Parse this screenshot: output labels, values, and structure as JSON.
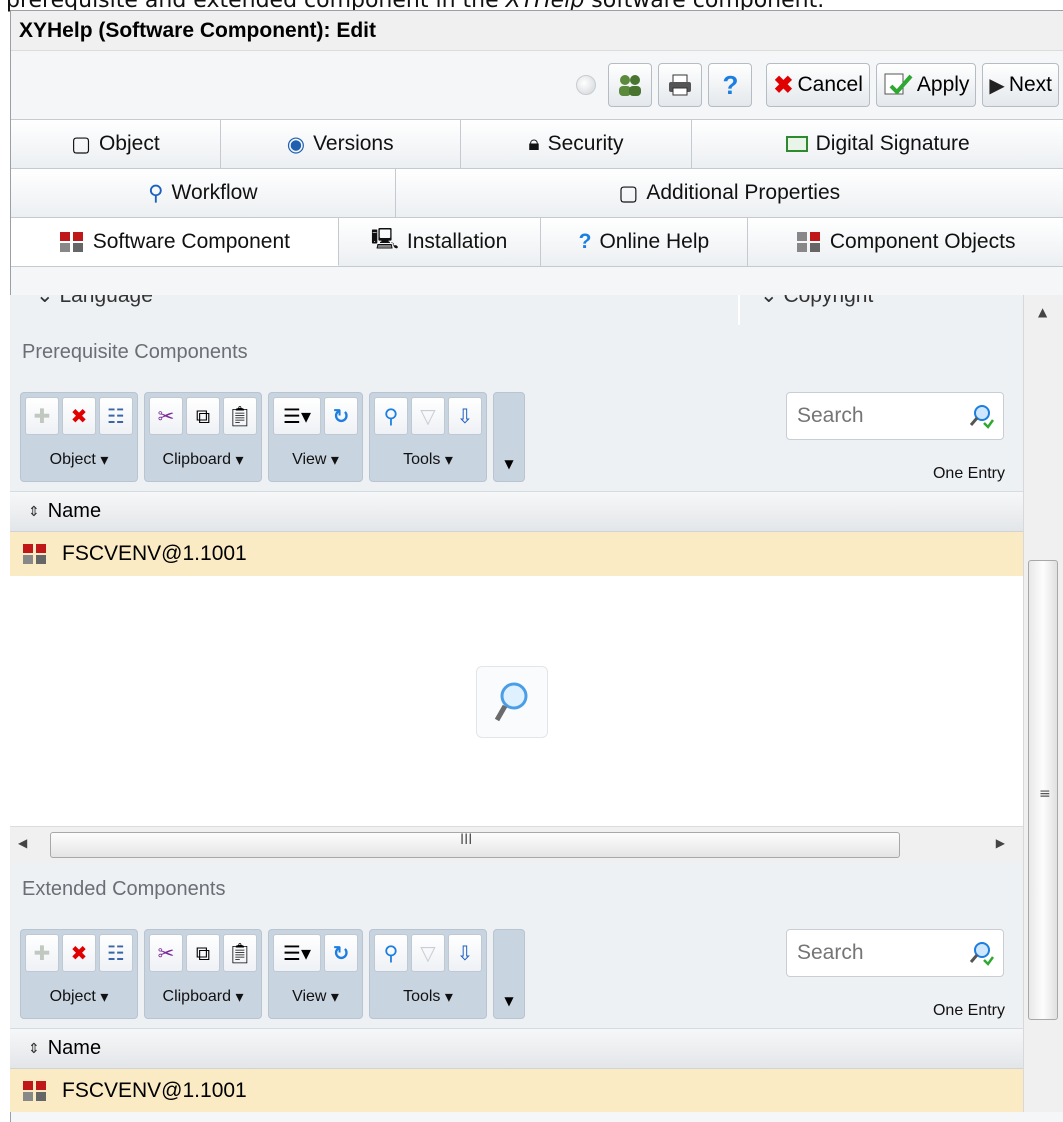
{
  "caption": {
    "text_a": "prerequisite and extended component in the ",
    "text_b": "XYHelp",
    "text_c": " software component."
  },
  "window": {
    "title": "XYHelp (Software Component): Edit"
  },
  "toolbar": {
    "cancel_label": "Cancel",
    "apply_label": "Apply",
    "next_label": "Next"
  },
  "tabs": {
    "row1": [
      "Object",
      "Versions",
      "Security",
      "Digital Signature"
    ],
    "row2": [
      "Workflow",
      "Additional Properties"
    ],
    "row3": [
      "Software Component",
      "Installation",
      "Online Help",
      "Component Objects"
    ]
  },
  "fields_cut": {
    "language": "Language",
    "copyright": "Copyright"
  },
  "prerequisite": {
    "title": "Prerequisite Components",
    "groups": [
      "Object",
      "Clipboard",
      "View",
      "Tools"
    ],
    "search_placeholder": "Search",
    "entry_count": "One Entry",
    "column": "Name",
    "rows": [
      "FSCVENV@1.1001"
    ]
  },
  "extended": {
    "title": "Extended Components",
    "groups": [
      "Object",
      "Clipboard",
      "View",
      "Tools"
    ],
    "search_placeholder": "Search",
    "entry_count": "One Entry",
    "column": "Name",
    "rows": [
      "FSCVENV@1.1001"
    ]
  },
  "scroll_glyphs": {
    "h_grip": "III",
    "v_grip": "≡"
  },
  "colors": {
    "row_highlight": "#faebc4",
    "ribbon_group": "#c9d4e1",
    "section_bg": "#eef1f4",
    "cancel_red": "#e00000",
    "help_blue": "#1b7ee0"
  }
}
